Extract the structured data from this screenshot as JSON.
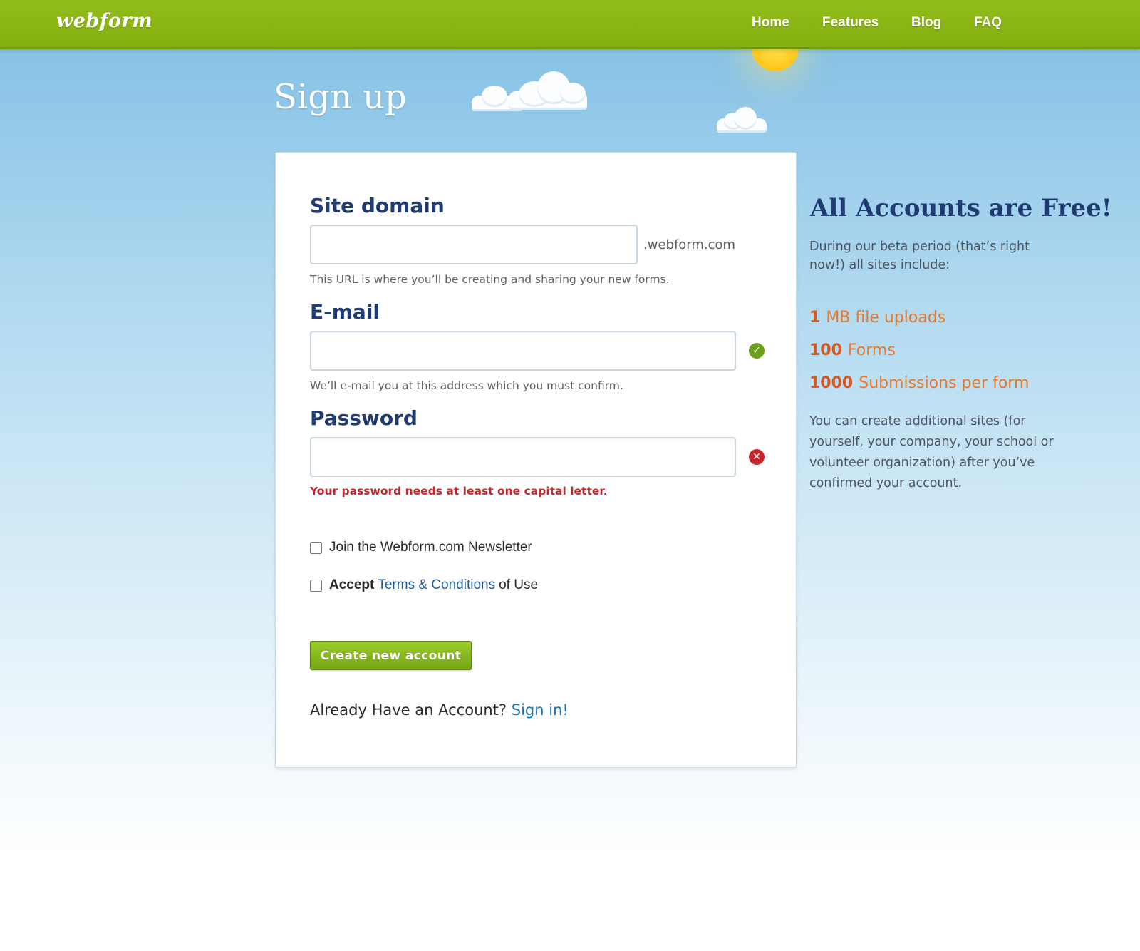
{
  "header": {
    "logo": "webform",
    "nav": [
      {
        "label": "Home"
      },
      {
        "label": "Features"
      },
      {
        "label": "Blog"
      },
      {
        "label": "FAQ"
      }
    ]
  },
  "page": {
    "title": "Sign up"
  },
  "form": {
    "site_domain": {
      "label": "Site domain",
      "value": "",
      "suffix": ".webform.com",
      "hint": "This URL is where you’ll be creating and sharing your new forms."
    },
    "email": {
      "label": "E-mail",
      "value": "",
      "hint": "We’ll e-mail you at this address which you must confirm.",
      "status": "valid"
    },
    "password": {
      "label": "Password",
      "value": "",
      "error": "Your password needs at least one capital letter.",
      "status": "invalid"
    },
    "newsletter": {
      "label": "Join the Webform.com Newsletter",
      "checked": false
    },
    "terms": {
      "prefix": "Accept",
      "link": "Terms & Conditions",
      "suffix": "of Use",
      "checked": false
    },
    "submit_label": "Create new account",
    "signin_prompt": "Already Have an Account?",
    "signin_link": "Sign in!"
  },
  "sidebar": {
    "title": "All Accounts are Free!",
    "intro_line1": "During our beta period (that’s right",
    "intro_line2": "now!) all sites include:",
    "perks": [
      {
        "amount": "1",
        "label": "MB file uploads"
      },
      {
        "amount": "100",
        "label": "Forms"
      },
      {
        "amount": "1000",
        "label": "Submissions per form"
      }
    ],
    "note_lines": [
      "You can create additional sites (for",
      "yourself, your company, your school or",
      "volunteer organization) after you’ve",
      "confirmed your account."
    ]
  },
  "colors": {
    "header_green": "#8bb514",
    "heading_navy": "#1f3b71",
    "perk_orange": "#e8792b",
    "error_red": "#c8252a",
    "valid_green": "#6aa01a",
    "link_blue": "#1e73b0"
  },
  "icons": {
    "email_status": "check-circle-icon",
    "password_status": "x-circle-icon"
  }
}
